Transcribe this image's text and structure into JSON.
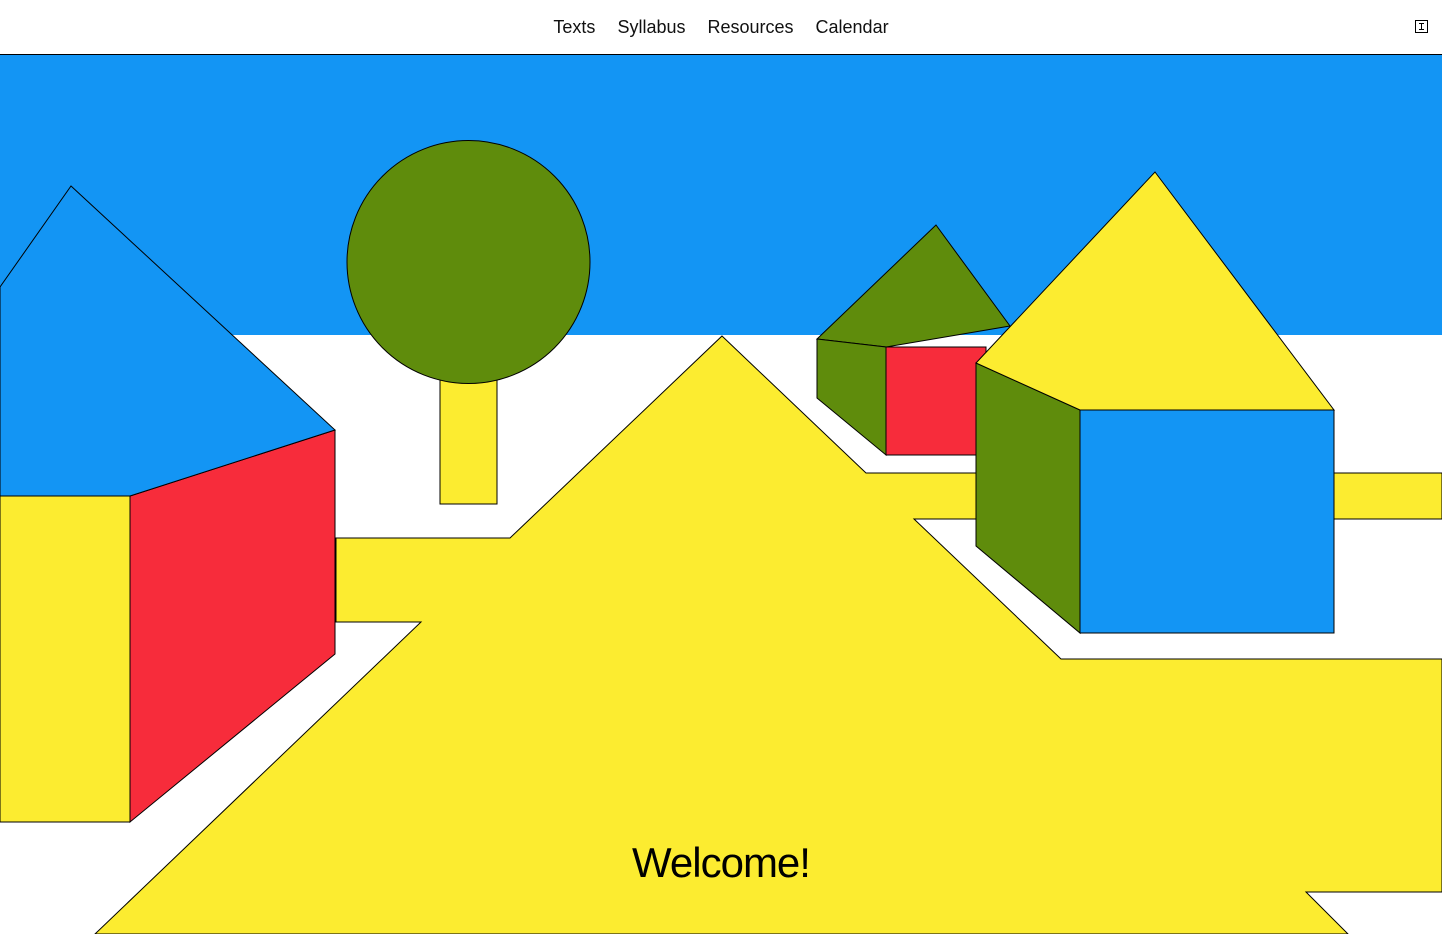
{
  "nav": {
    "items": [
      {
        "label": "Texts"
      },
      {
        "label": "Syllabus"
      },
      {
        "label": "Resources"
      },
      {
        "label": "Calendar"
      }
    ]
  },
  "menu_button": {
    "icon": "text-cursor-icon"
  },
  "hero": {
    "heading": "Welcome!"
  },
  "colors": {
    "sky": "#1395F4",
    "yellow": "#FCEC30",
    "green": "#5F8C0C",
    "red": "#F72C3B",
    "white": "#FFFFFF"
  }
}
